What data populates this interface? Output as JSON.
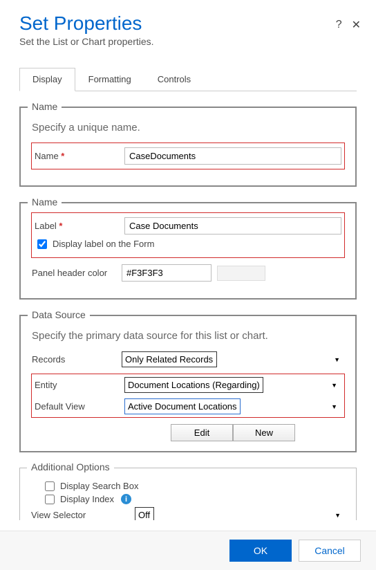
{
  "header": {
    "title": "Set Properties",
    "subtitle": "Set the List or Chart properties."
  },
  "tabs": [
    "Display",
    "Formatting",
    "Controls"
  ],
  "name_section": {
    "legend": "Name",
    "desc": "Specify a unique name.",
    "name_label": "Name",
    "name_value": "CaseDocuments"
  },
  "label_section": {
    "legend": "Name",
    "label_label": "Label",
    "label_value": "Case Documents",
    "display_on_form_label": "Display label on the Form",
    "display_on_form_checked": true,
    "panel_color_label": "Panel header color",
    "panel_color_value": "#F3F3F3"
  },
  "data_source": {
    "legend": "Data Source",
    "desc": "Specify the primary data source for this list or chart.",
    "records_label": "Records",
    "records_value": "Only Related Records",
    "entity_label": "Entity",
    "entity_value": "Document Locations (Regarding)",
    "default_view_label": "Default View",
    "default_view_value": "Active Document Locations",
    "edit_btn": "Edit",
    "new_btn": "New"
  },
  "additional": {
    "legend": "Additional Options",
    "search_box_label": "Display Search Box",
    "search_box_checked": false,
    "display_index_label": "Display Index",
    "display_index_checked": false,
    "view_selector_label": "View Selector",
    "view_selector_value": "Off"
  },
  "footer": {
    "ok": "OK",
    "cancel": "Cancel"
  }
}
